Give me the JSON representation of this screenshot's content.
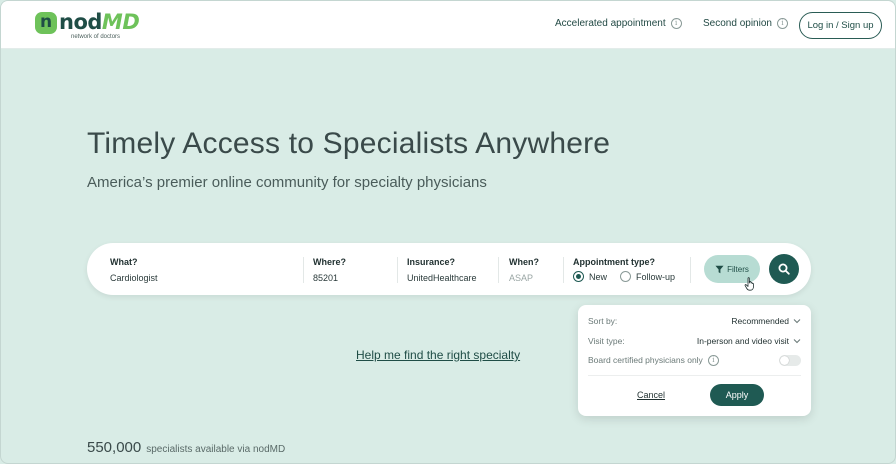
{
  "header": {
    "logo": {
      "mark": "n",
      "text_main": "nod",
      "text_accent": "MD",
      "tagline": "network of doctors"
    },
    "nav": [
      {
        "label": "Accelerated appointment",
        "icon": "info-icon"
      },
      {
        "label": "Second opinion",
        "icon": "info-icon"
      }
    ],
    "login_label": "Log in / Sign up"
  },
  "hero": {
    "title": "Timely Access to Specialists Anywhere",
    "subtitle": "America’s premier online community for specialty physicians"
  },
  "search": {
    "what": {
      "label": "What?",
      "value": "Cardiologist"
    },
    "where": {
      "label": "Where?",
      "value": "85201"
    },
    "insurance": {
      "label": "Insurance?",
      "value": "UnitedHealthcare"
    },
    "when": {
      "label": "When?",
      "placeholder": "ASAP"
    },
    "appointment_type": {
      "label": "Appointment type?",
      "options": [
        {
          "label": "New",
          "checked": true
        },
        {
          "label": "Follow-up",
          "checked": false
        }
      ]
    },
    "filters_label": "Filters",
    "search_icon": "search-icon"
  },
  "help_link": "Help me find the right specialty",
  "filters_panel": {
    "sort_by": {
      "label": "Sort by:",
      "value": "Recommended"
    },
    "visit_type": {
      "label": "Visit type:",
      "value": "In-person and video visit"
    },
    "board_certified": {
      "label": "Board certified physicians only",
      "enabled": false
    },
    "cancel_label": "Cancel",
    "apply_label": "Apply"
  },
  "stats": {
    "count": "550,000",
    "text": "specialists available via nodMD"
  },
  "colors": {
    "background": "#d9ece6",
    "primary": "#1f5a53",
    "accent_green": "#6ec25a",
    "filters_bg": "#b7dcd3"
  }
}
